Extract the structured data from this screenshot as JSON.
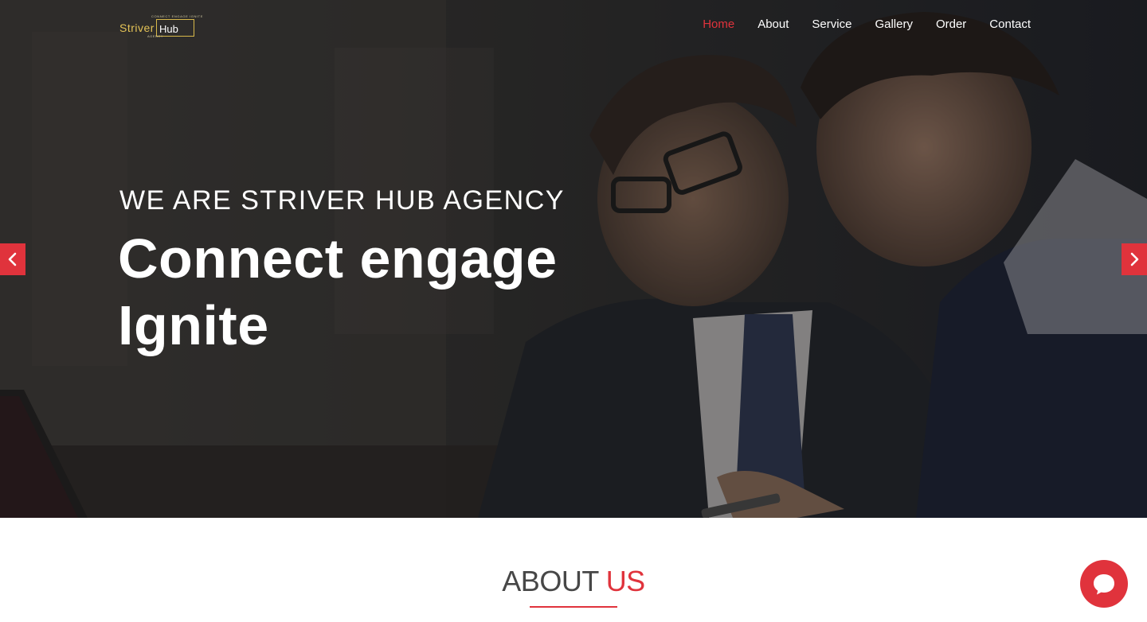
{
  "brand": {
    "tagline": "CONNECT ENGAGE IGNITE",
    "word1": "Striver",
    "word2": "Hub",
    "sub": "AGENCY",
    "logo_color": "#d8b94a"
  },
  "nav": {
    "items": [
      {
        "label": "Home",
        "active": true
      },
      {
        "label": "About",
        "active": false
      },
      {
        "label": "Service",
        "active": false
      },
      {
        "label": "Gallery",
        "active": false
      },
      {
        "label": "Order",
        "active": false
      },
      {
        "label": "Contact",
        "active": false
      }
    ]
  },
  "hero": {
    "kicker": "WE ARE STRIVER HUB AGENCY",
    "title_line1": "Connect engage",
    "title_line2": "Ignite",
    "prev_icon": "chevron-left-icon",
    "next_icon": "chevron-right-icon"
  },
  "about": {
    "title_part1": "ABOUT",
    "title_part2": "US"
  },
  "chat": {
    "icon": "chat-bubble-icon"
  },
  "colors": {
    "accent": "#e0333c",
    "heading": "#474747"
  }
}
